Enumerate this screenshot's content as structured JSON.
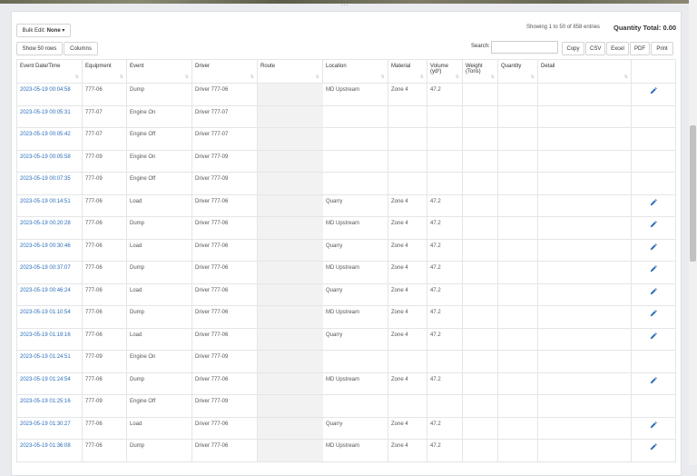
{
  "toolbar": {
    "bulk_edit_label": "Bulk Edit:",
    "bulk_edit_value": "None",
    "show_rows_label": "Show 50 rows",
    "columns_label": "Columns",
    "entries_info": "Showing 1 to 50 of 858 entries",
    "quantity_total": "Quantity Total: 0.00",
    "search_label": "Search:",
    "search_value": "",
    "export_buttons": [
      "Copy",
      "CSV",
      "Excel",
      "PDF",
      "Print"
    ]
  },
  "table": {
    "columns": [
      {
        "label": "Event Date/Time",
        "sub": ""
      },
      {
        "label": "Equipment",
        "sub": ""
      },
      {
        "label": "Event",
        "sub": ""
      },
      {
        "label": "Driver",
        "sub": ""
      },
      {
        "label": "Route",
        "sub": ""
      },
      {
        "label": "Location",
        "sub": ""
      },
      {
        "label": "Material",
        "sub": ""
      },
      {
        "label": "Volume",
        "sub": "(yd³)"
      },
      {
        "label": "Weight",
        "sub": "(Tons)"
      },
      {
        "label": "Quantity",
        "sub": ""
      },
      {
        "label": "Detail",
        "sub": ""
      },
      {
        "label": "",
        "sub": ""
      }
    ],
    "rows": [
      {
        "datetime": "2023-05-19 00:04:58",
        "equipment": "777-06",
        "event": "Dump",
        "driver": "Driver 777-06",
        "route": "",
        "location": "MD Upstream",
        "material": "Zone 4",
        "volume": "47.2",
        "weight": "",
        "quantity": "",
        "detail": "",
        "editable": true
      },
      {
        "datetime": "2023-05-19 00:05:31",
        "equipment": "777-07",
        "event": "Engine On",
        "driver": "Driver 777-07",
        "route": "",
        "location": "",
        "material": "",
        "volume": "",
        "weight": "",
        "quantity": "",
        "detail": "",
        "editable": false
      },
      {
        "datetime": "2023-05-19 00:05:42",
        "equipment": "777-07",
        "event": "Engine Off",
        "driver": "Driver 777-07",
        "route": "",
        "location": "",
        "material": "",
        "volume": "",
        "weight": "",
        "quantity": "",
        "detail": "",
        "editable": false
      },
      {
        "datetime": "2023-05-19 00:05:58",
        "equipment": "777-09",
        "event": "Engine On",
        "driver": "Driver 777-09",
        "route": "",
        "location": "",
        "material": "",
        "volume": "",
        "weight": "",
        "quantity": "",
        "detail": "",
        "editable": false
      },
      {
        "datetime": "2023-05-19 00:07:35",
        "equipment": "777-09",
        "event": "Engine Off",
        "driver": "Driver 777-09",
        "route": "",
        "location": "",
        "material": "",
        "volume": "",
        "weight": "",
        "quantity": "",
        "detail": "",
        "editable": false
      },
      {
        "datetime": "2023-05-19 00:14:51",
        "equipment": "777-06",
        "event": "Load",
        "driver": "Driver 777-06",
        "route": "",
        "location": "Quarry",
        "material": "Zone 4",
        "volume": "47.2",
        "weight": "",
        "quantity": "",
        "detail": "",
        "editable": true
      },
      {
        "datetime": "2023-05-19 00:20:28",
        "equipment": "777-06",
        "event": "Dump",
        "driver": "Driver 777-06",
        "route": "",
        "location": "MD Upstream",
        "material": "Zone 4",
        "volume": "47.2",
        "weight": "",
        "quantity": "",
        "detail": "",
        "editable": true
      },
      {
        "datetime": "2023-05-19 00:30:46",
        "equipment": "777-06",
        "event": "Load",
        "driver": "Driver 777-06",
        "route": "",
        "location": "Quarry",
        "material": "Zone 4",
        "volume": "47.2",
        "weight": "",
        "quantity": "",
        "detail": "",
        "editable": true
      },
      {
        "datetime": "2023-05-19 00:37:07",
        "equipment": "777-06",
        "event": "Dump",
        "driver": "Driver 777-06",
        "route": "",
        "location": "MD Upstream",
        "material": "Zone 4",
        "volume": "47.2",
        "weight": "",
        "quantity": "",
        "detail": "",
        "editable": true
      },
      {
        "datetime": "2023-05-19 00:46:24",
        "equipment": "777-06",
        "event": "Load",
        "driver": "Driver 777-06",
        "route": "",
        "location": "Quarry",
        "material": "Zone 4",
        "volume": "47.2",
        "weight": "",
        "quantity": "",
        "detail": "",
        "editable": true
      },
      {
        "datetime": "2023-05-19 01:10:54",
        "equipment": "777-06",
        "event": "Dump",
        "driver": "Driver 777-06",
        "route": "",
        "location": "MD Upstream",
        "material": "Zone 4",
        "volume": "47.2",
        "weight": "",
        "quantity": "",
        "detail": "",
        "editable": true
      },
      {
        "datetime": "2023-05-19 01:19:16",
        "equipment": "777-06",
        "event": "Load",
        "driver": "Driver 777-06",
        "route": "",
        "location": "Quarry",
        "material": "Zone 4",
        "volume": "47.2",
        "weight": "",
        "quantity": "",
        "detail": "",
        "editable": true
      },
      {
        "datetime": "2023-05-19 01:24:51",
        "equipment": "777-09",
        "event": "Engine On",
        "driver": "Driver 777-09",
        "route": "",
        "location": "",
        "material": "",
        "volume": "",
        "weight": "",
        "quantity": "",
        "detail": "",
        "editable": false
      },
      {
        "datetime": "2023-05-19 01:24:54",
        "equipment": "777-06",
        "event": "Dump",
        "driver": "Driver 777-06",
        "route": "",
        "location": "MD Upstream",
        "material": "Zone 4",
        "volume": "47.2",
        "weight": "",
        "quantity": "",
        "detail": "",
        "editable": true
      },
      {
        "datetime": "2023-05-19 01:25:16",
        "equipment": "777-09",
        "event": "Engine Off",
        "driver": "Driver 777-09",
        "route": "",
        "location": "",
        "material": "",
        "volume": "",
        "weight": "",
        "quantity": "",
        "detail": "",
        "editable": false
      },
      {
        "datetime": "2023-05-19 01:30:27",
        "equipment": "777-06",
        "event": "Load",
        "driver": "Driver 777-06",
        "route": "",
        "location": "Quarry",
        "material": "Zone 4",
        "volume": "47.2",
        "weight": "",
        "quantity": "",
        "detail": "",
        "editable": true
      },
      {
        "datetime": "2023-05-19 01:36:08",
        "equipment": "777-06",
        "event": "Dump",
        "driver": "Driver 777-06",
        "route": "",
        "location": "MD Upstream",
        "material": "Zone 4",
        "volume": "47.2",
        "weight": "",
        "quantity": "",
        "detail": "",
        "editable": true
      }
    ]
  },
  "colors": {
    "link": "#2a6ebb",
    "edit_icon": "#2a6ebb"
  },
  "icons": {
    "edit": "pencil-icon",
    "sort": "sort-icon"
  }
}
